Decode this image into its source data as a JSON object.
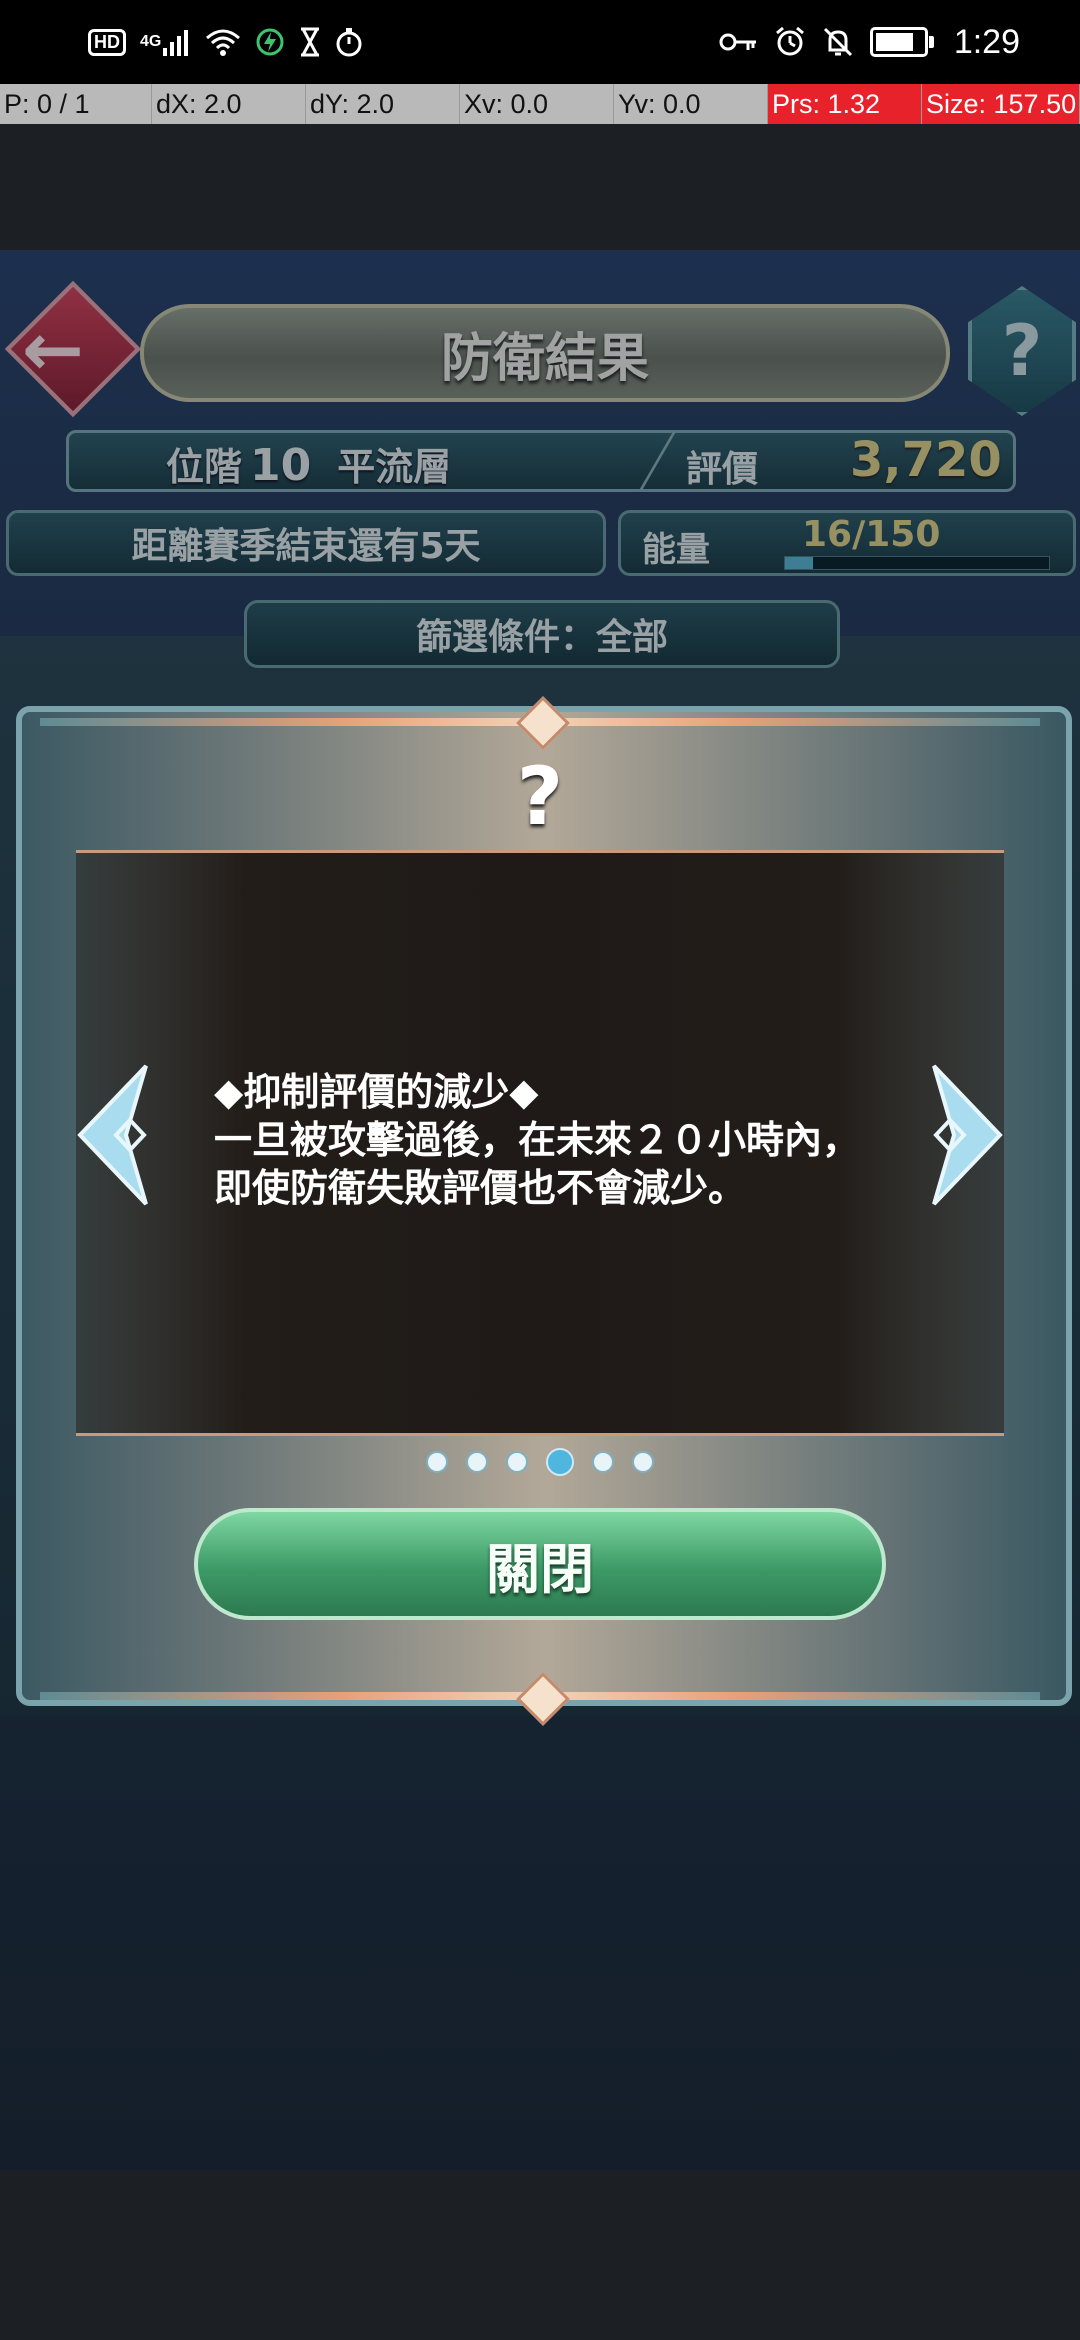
{
  "status_bar": {
    "badges": [
      "HD",
      "4G"
    ],
    "time": "1:29",
    "battery_level": 0.8,
    "icons": [
      "hd-icon",
      "signal-icon",
      "wifi-icon",
      "charging-icon",
      "hourglass-icon",
      "stopwatch-icon",
      "key-icon",
      "alarm-icon",
      "mute-icon",
      "battery-icon"
    ]
  },
  "debug_bar": {
    "p": "P: 0 / 1",
    "dx": "dX: 2.0",
    "dy": "dY: 2.0",
    "xv": "Xv: 0.0",
    "yv": "Yv: 0.0",
    "prs": "Prs: 1.32",
    "size": "Size: 157.50"
  },
  "header": {
    "title": "防衛結果",
    "help_glyph": "?",
    "back_glyph": "←"
  },
  "rank": {
    "label": "位階",
    "number": "10",
    "tier": "平流層",
    "rating_label": "評價",
    "rating_value": "3,720"
  },
  "season": {
    "text": "距離賽季結束還有5天"
  },
  "energy": {
    "label": "能量",
    "value": "16/150",
    "fraction": 0.107
  },
  "filter": {
    "text": "篩選條件：全部"
  },
  "modal": {
    "help_glyph": "?",
    "tip_lines": "◆抑制評價的減少◆\n一旦被攻擊過後，在未來２０小時內，\n即使防衛失敗評價也不會減少。",
    "page_count": 6,
    "active_page": 4,
    "close_label": "關閉"
  }
}
